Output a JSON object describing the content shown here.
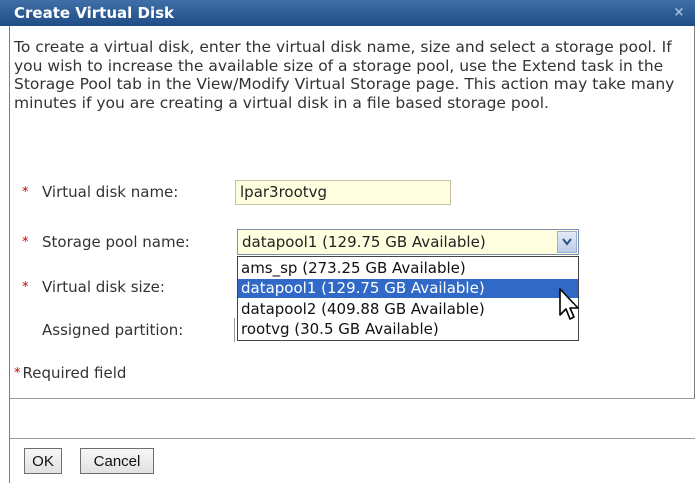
{
  "dialog": {
    "title": "Create Virtual Disk",
    "close_glyph": "×",
    "intro": "To create a virtual disk, enter the virtual disk name, size and select a storage pool. If you wish to increase the available size of a storage pool, use the Extend task in the Storage Pool tab in the View/Modify Virtual Storage page. This action may take many minutes if you are creating a virtual disk in a file based storage pool."
  },
  "form": {
    "required_marker": "*",
    "disk_name_label": "Virtual disk name:",
    "disk_name_value": "lpar3rootvg",
    "pool_label": "Storage pool name:",
    "pool_selected": "datapool1 (129.75 GB Available)",
    "pool_options": [
      "ams_sp (273.25 GB Available)",
      "datapool1 (129.75 GB Available)",
      "datapool2 (409.88 GB Available)",
      "rootvg (30.5 GB Available)"
    ],
    "size_label": "Virtual disk size:",
    "partition_label": "Assigned partition:",
    "required_note": "Required field"
  },
  "buttons": {
    "ok": "OK",
    "cancel": "Cancel"
  },
  "colors": {
    "title_bar": "#1f4d86",
    "required": "#cc0000",
    "field_bg": "#ffffe0",
    "selection": "#3169c6"
  },
  "icons": {
    "dropdown": "chevron-down-icon",
    "pointer": "mouse-pointer-icon"
  }
}
